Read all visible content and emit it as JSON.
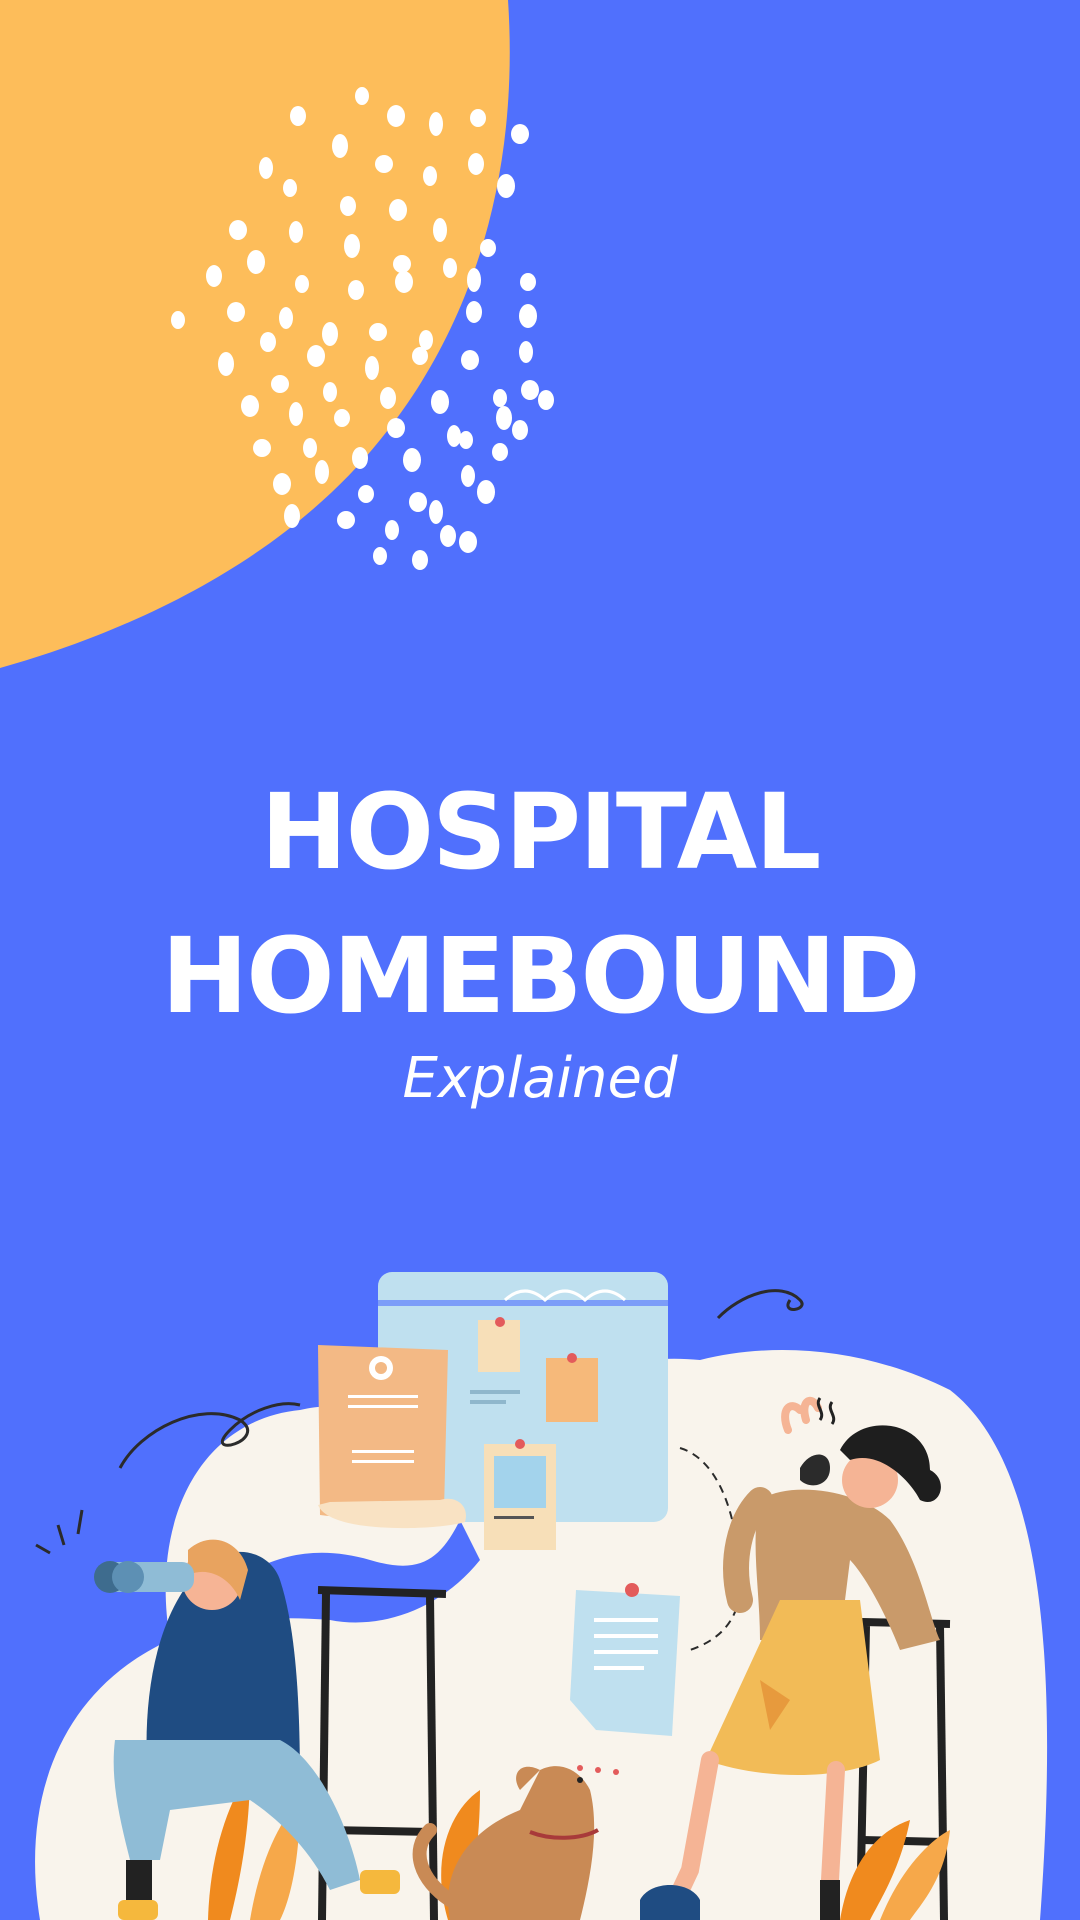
{
  "title": {
    "line1": "HOSPITAL",
    "line2": "HOMEBOUND",
    "subtitle": "Explained"
  },
  "colors": {
    "background": "#5070fd",
    "blob": "#fdbd5a",
    "dots": "#ffffff",
    "cream": "#f9f4ec",
    "board": "#bfe0ef"
  }
}
